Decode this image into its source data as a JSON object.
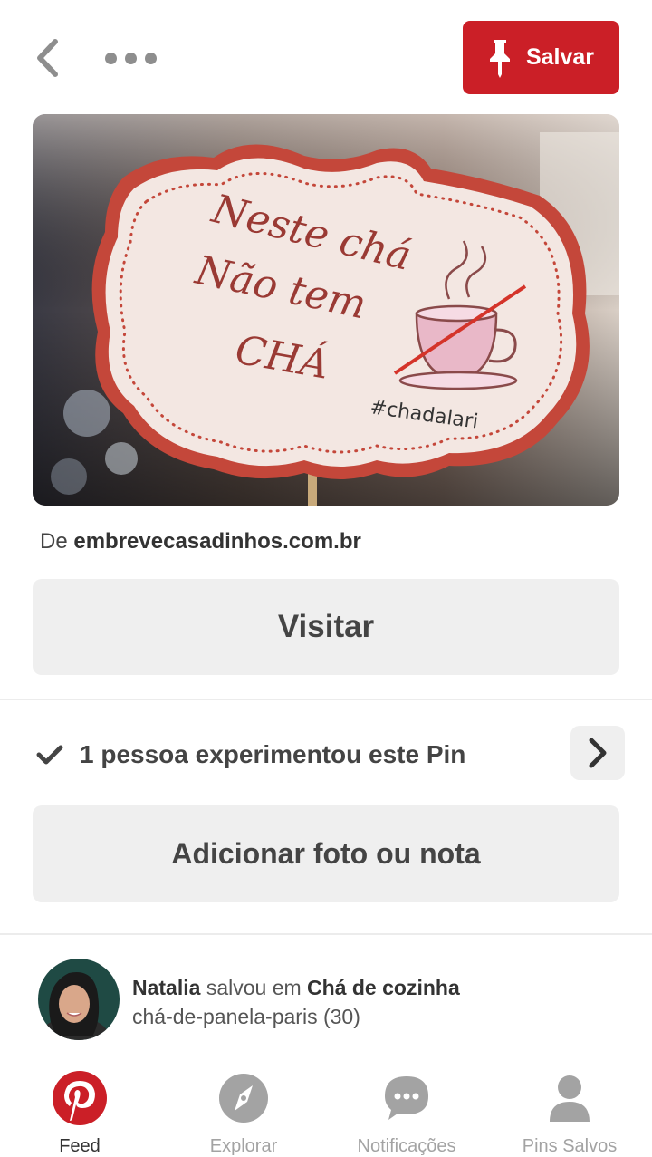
{
  "header": {
    "back_icon": "chevron-left-icon",
    "more_icon": "more-dots-icon",
    "save_label": "Salvar",
    "save_icon": "pushpin-icon",
    "accent_color": "#cb1f27"
  },
  "pin": {
    "image_text": {
      "line1": "Neste chá",
      "line2": "Não tem",
      "line3": "CHÁ",
      "hashtag": "#chadalari"
    },
    "source_prefix": "De",
    "source_domain": "embrevecasadinhos.com.br",
    "visit_label": "Visitar"
  },
  "tried": {
    "check_icon": "checkmark-icon",
    "text": "1 pessoa experimentou este Pin",
    "arrow_icon": "chevron-right-icon",
    "add_label": "Adicionar foto ou nota"
  },
  "saver": {
    "name": "Natalia",
    "action": "salvou em",
    "board": "Chá de cozinha",
    "subtitle": "chá-de-panela-paris (30)"
  },
  "tabbar": {
    "items": [
      {
        "label": "Feed",
        "icon": "pinterest-logo-icon",
        "active": true
      },
      {
        "label": "Explorar",
        "icon": "compass-icon",
        "active": false
      },
      {
        "label": "Notificações",
        "icon": "chat-bubble-icon",
        "active": false
      },
      {
        "label": "Pins Salvos",
        "icon": "profile-icon",
        "active": false
      }
    ]
  }
}
